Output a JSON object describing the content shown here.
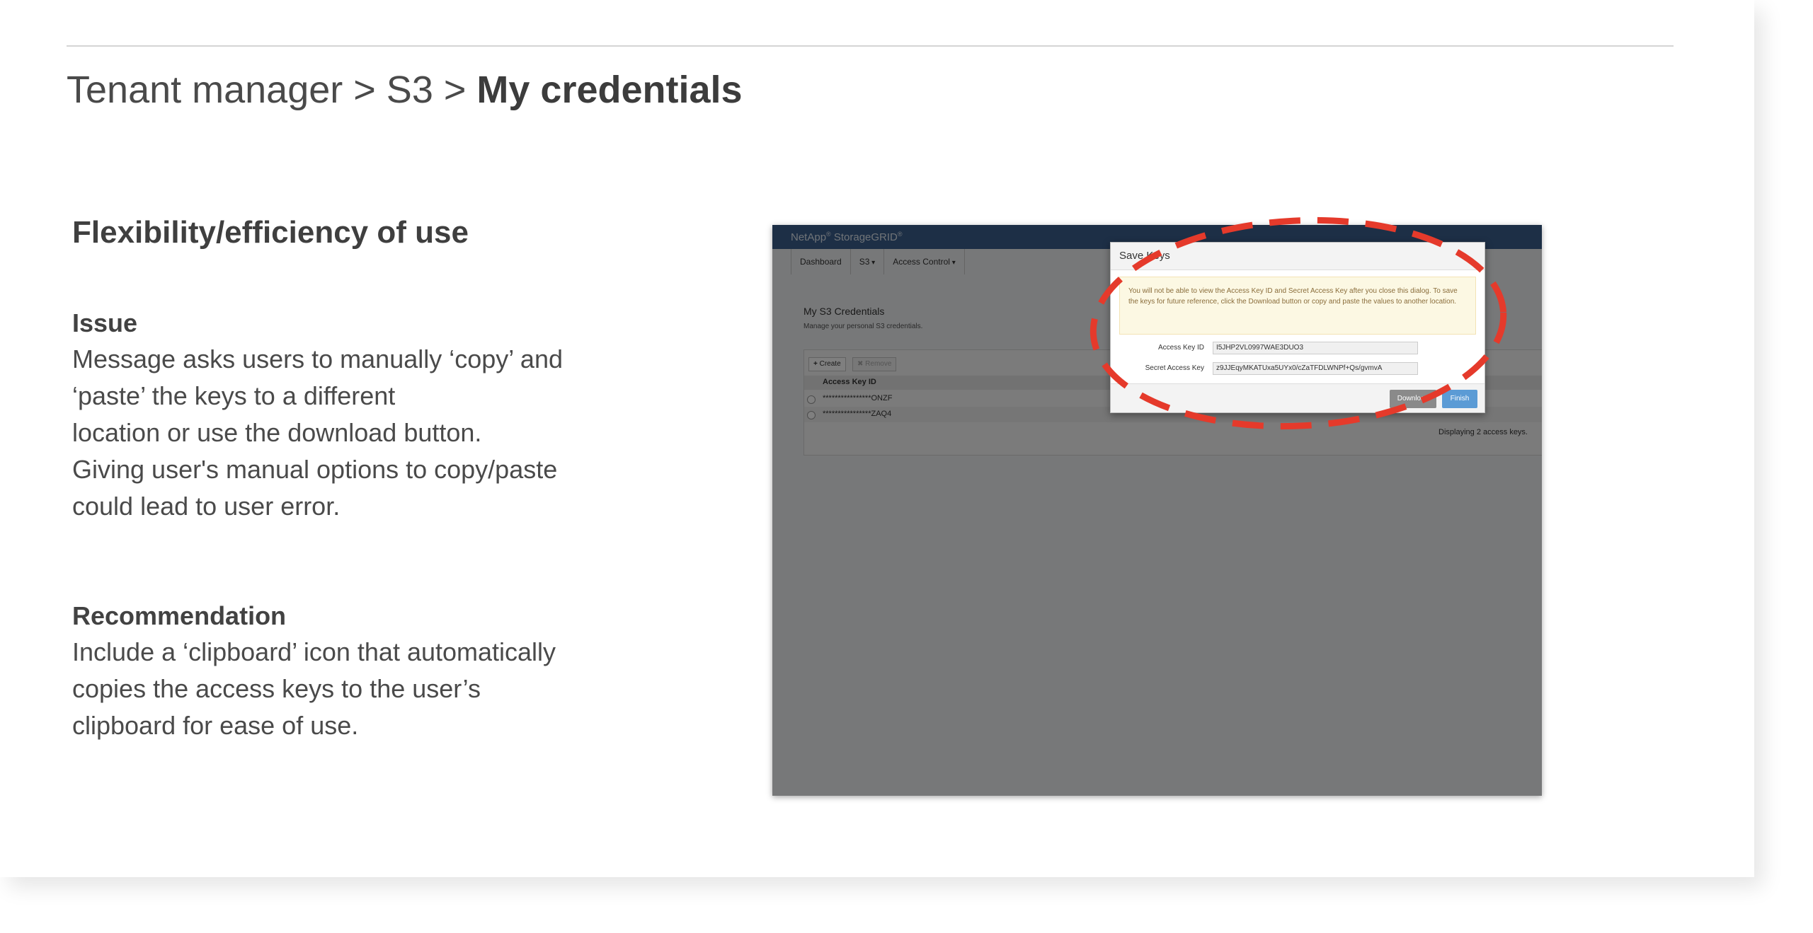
{
  "slide": {
    "breadcrumb": {
      "part1": "Tenant manager > S3 > ",
      "current": "My credentials"
    },
    "heading": "Flexibility/efficiency of use",
    "issue": {
      "title": "Issue",
      "lines": [
        "Message asks users to manually ‘copy’ and",
        "‘paste’ the keys to a different",
        "location or use the download button.",
        "Giving user's manual options to copy/paste",
        "could lead to user error."
      ]
    },
    "recommendation": {
      "title": "Recommendation",
      "lines": [
        "Include a ‘clipboard’ icon that automatically",
        "copies the access keys to the user’s",
        "clipboard for ease of use."
      ]
    }
  },
  "screenshot": {
    "brand": "NetApp",
    "brand_suffix": " StorageGRID",
    "nav": {
      "dashboard": "Dashboard",
      "s3": "S3",
      "access_control": "Access Control"
    },
    "page_title": "My S3 Credentials",
    "page_subtitle": "Manage your personal S3 credentials.",
    "toolbar": {
      "create": "Create",
      "remove": "Remove"
    },
    "table": {
      "header": "Access Key ID",
      "rows": [
        "****************ONZF",
        "****************ZAQ4"
      ]
    },
    "footer_text": "Displaying 2 access keys.",
    "modal": {
      "title": "Save Keys",
      "warning": "You will not be able to view the Access Key ID and Secret Access Key after you close this dialog. To save the keys for future reference, click the Download button or copy and paste the values to another location.",
      "access_key_label": "Access Key ID",
      "access_key_value": "I5JHP2VL0997WAE3DUO3",
      "secret_key_label": "Secret Access Key",
      "secret_key_value": "z9JJEqyMKATUxa5UYx0/cZaTFDLWNPf+Qs/gvmvA",
      "download_label": "Download",
      "finish_label": "Finish"
    },
    "highlight_color": "#e53a2b"
  }
}
